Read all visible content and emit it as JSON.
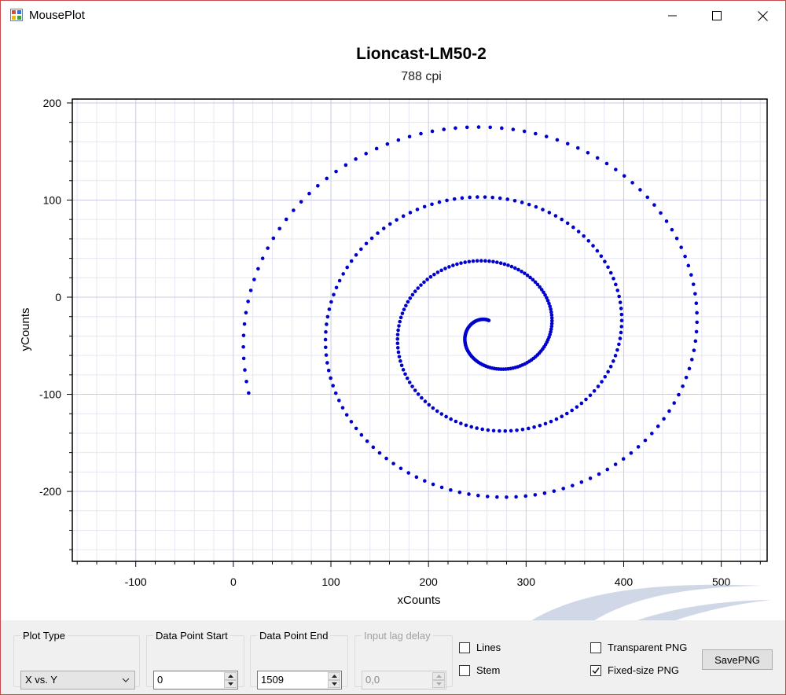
{
  "window": {
    "title": "MousePlot",
    "app_icon": "window-app-icon",
    "controls": [
      "minimize-icon",
      "maximize-icon",
      "close-icon"
    ]
  },
  "chart_data": {
    "type": "scatter",
    "title": "Lioncast-LM50-2",
    "subtitle": "788 cpi",
    "xlabel": "xCounts",
    "ylabel": "yCounts",
    "xlim": [
      -165,
      547
    ],
    "ylim": [
      -272,
      204
    ],
    "xticks": [
      -100,
      0,
      100,
      200,
      300,
      400,
      500
    ],
    "yticks": [
      -200,
      -100,
      0,
      100,
      200
    ],
    "grid": true,
    "marker_color": "#0000cc",
    "spiral": {
      "cx": 265,
      "cy": -34,
      "r_start": 247,
      "r_end": 11,
      "turns": 3.25,
      "theta_start_deg": 196,
      "point_count": 400
    }
  },
  "controls": {
    "plot_type": {
      "label": "Plot Type",
      "value": "X vs. Y"
    },
    "data_point_start": {
      "label": "Data Point Start",
      "value": "0"
    },
    "data_point_end": {
      "label": "Data Point End",
      "value": "1509"
    },
    "input_lag_delay": {
      "label": "Input lag delay",
      "value": "0,0"
    },
    "lines": {
      "label": "Lines",
      "checked": false
    },
    "stem": {
      "label": "Stem",
      "checked": false
    },
    "transparent_png": {
      "label": "Transparent PNG",
      "checked": false
    },
    "fixed_size_png": {
      "label": "Fixed-size PNG",
      "checked": true
    },
    "save_png": {
      "label": "SavePNG"
    }
  }
}
